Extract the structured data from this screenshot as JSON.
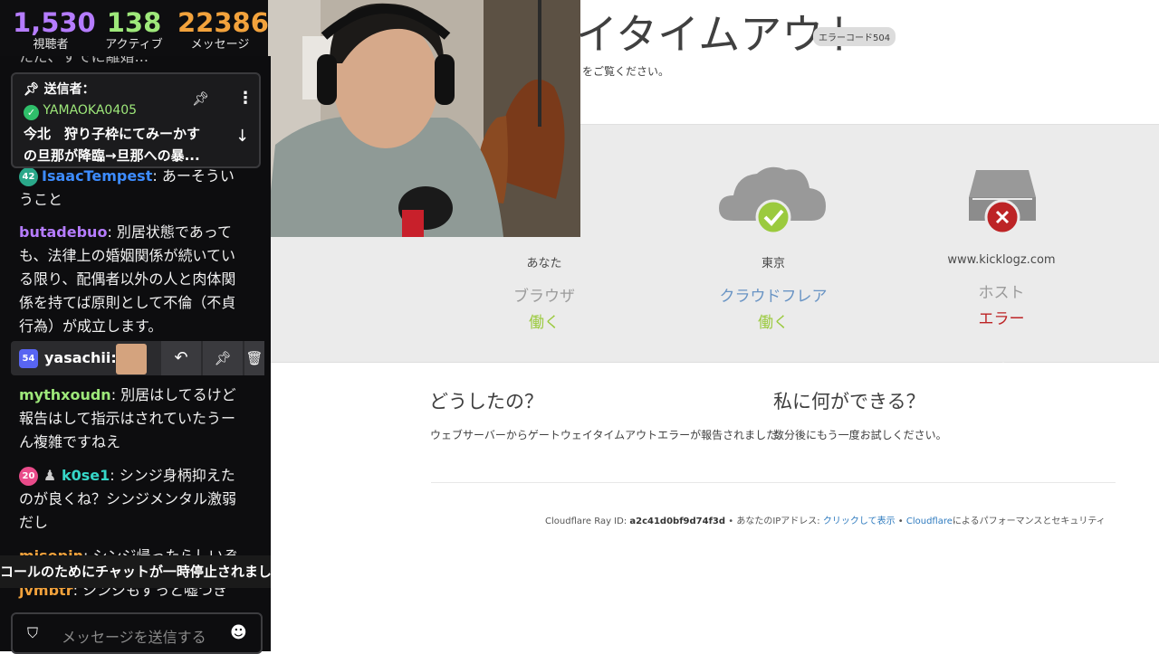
{
  "stats": [
    {
      "value": "1,530",
      "label": "視聴者",
      "color": "#b57cff"
    },
    {
      "value": "138",
      "label": "アクティブ",
      "color": "#9ee87a"
    },
    {
      "value": "22386",
      "label": "メッセージ",
      "color": "#f2a23c"
    }
  ],
  "pinned": {
    "header": "送信者：",
    "user": "YAMAOKA0405",
    "text_line1": "今北　狩り子枠にてみーかす",
    "text_line2": "の旦那が降臨→旦那への暴..."
  },
  "chat": {
    "truncated_top": "ただ、すでに離婚...",
    "messages": [
      {
        "badge": "42",
        "badge_color": "#2aa88a",
        "user": "IsaacTempest",
        "user_color": "#3d8cff",
        "text": ": あーそういうこと"
      },
      {
        "user": "butadebuo",
        "user_color": "#b57cff",
        "text": ": 別居状態であっても、法律上の婚姻関係が続いている限り、配偶者以外の人と肉体関係を持てば原則として不倫（不貞行為）が成立します。"
      },
      {
        "user": "mythxoudn",
        "user_color": "#9ee87a",
        "text": ": 別居はしてるけど報告はして指示はされていたうーん複雑ですねえ"
      },
      {
        "badge": "20",
        "badge_color": "#e94b8a",
        "user": "k0se1",
        "user_color": "#36d6c8",
        "text": ": シンジ身柄抑えたのが良くね？シンジメンタル激弱だし"
      },
      {
        "user": "misopin",
        "user_color": "#f2a23c",
        "text": ": シンジ帰ったらしいぞ"
      },
      {
        "user": "jvmbtr",
        "user_color": "#f2a23c",
        "text": ": シンジもずっと嘘つき"
      }
    ],
    "mod_row": {
      "badge": "54",
      "user": "yasachii:"
    },
    "paused_text": "コールのためにチャットが一時停止されました",
    "input_placeholder": "メッセージを送信する"
  },
  "cloudflare": {
    "title": "イタイムアウト",
    "error_code": "エラーコード504",
    "subtitle": "をご覧ください。",
    "columns": [
      {
        "location": "あなた",
        "role": "ブラウザ",
        "status": "働く"
      },
      {
        "location": "東京",
        "role": "クラウドフレア",
        "status": "働く"
      },
      {
        "location": "www.kicklogz.com",
        "role": "ホスト",
        "status": "エラー"
      }
    ],
    "what_happened_title": "どうしたの？",
    "what_happened_text": "ウェブサーバーからゲートウェイタイムアウトエラーが報告されました。",
    "what_can_i_do_title": "私に何ができる？",
    "what_can_i_do_text": "数分後にもう一度お試しください。",
    "footer_ray_label": "Cloudflare Ray ID:",
    "footer_ray_id": "a2c41d0bf9d74f3d",
    "footer_ip_label": "• あなたのIPアドレス:",
    "footer_ip_link": "クリックして表示",
    "footer_sep": "•",
    "footer_cf_link": "Cloudflare",
    "footer_perf": "によるパフォーマンスとセキュリティ"
  },
  "colors": {
    "ok": "#9bca3e",
    "error": "#bd2426",
    "cloudflare_blue": "#6994c4",
    "chat_bg": "#0d0d0f"
  }
}
